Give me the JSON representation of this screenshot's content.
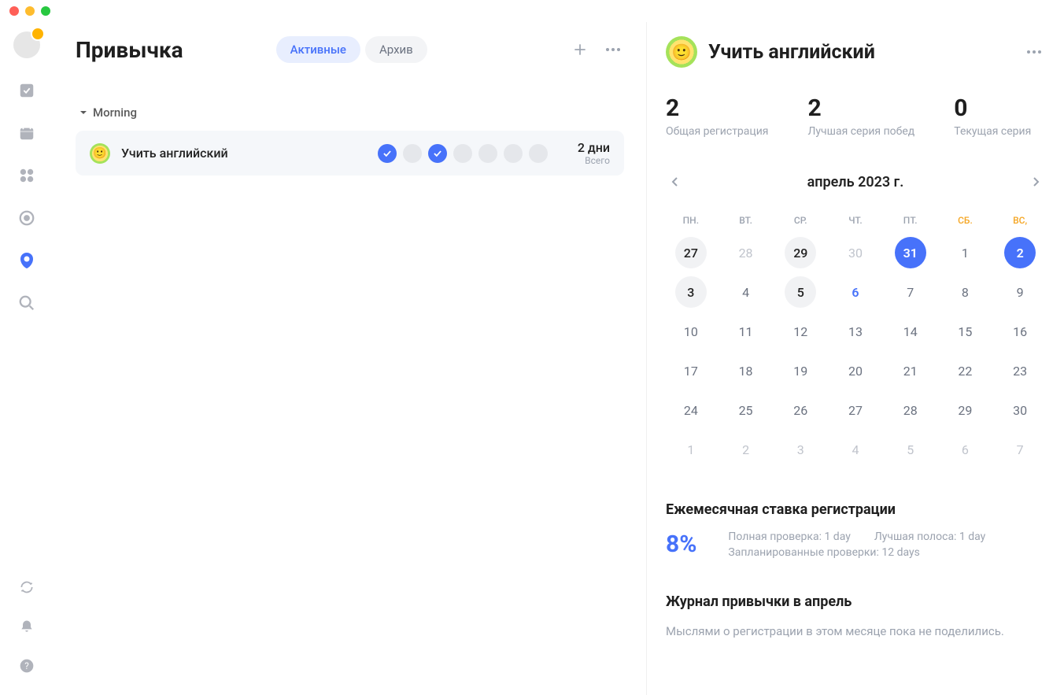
{
  "titlebar": {
    "dots": [
      "close",
      "minimize",
      "maximize"
    ]
  },
  "sidenav": {
    "items": [
      {
        "name": "tasks",
        "active": false
      },
      {
        "name": "calendar",
        "active": false
      },
      {
        "name": "matrix",
        "active": false
      },
      {
        "name": "focus",
        "active": false
      },
      {
        "name": "habit",
        "active": true
      },
      {
        "name": "search",
        "active": false
      }
    ],
    "bottom": [
      "sync",
      "notifications",
      "help"
    ]
  },
  "list": {
    "title": "Привычка",
    "tabs": {
      "active": "Активные",
      "archive": "Архив"
    },
    "section": "Morning",
    "habit": {
      "name": "Учить английский",
      "checks": [
        true,
        false,
        true,
        false,
        false,
        false,
        false
      ],
      "days_value": "2 дни",
      "days_label": "Всего"
    }
  },
  "detail": {
    "title": "Учить английский",
    "stats": [
      {
        "num": "2",
        "label": "Общая регистрация"
      },
      {
        "num": "2",
        "label": "Лучшая серия побед"
      },
      {
        "num": "0",
        "label": "Текущая серия"
      }
    ],
    "calendar": {
      "month": "апрель 2023 г.",
      "dow": [
        "ПН.",
        "ВТ.",
        "СР.",
        "ЧТ.",
        "ПТ.",
        "СБ.",
        "ВС,"
      ],
      "days": [
        {
          "d": "27",
          "cls": "other highlight"
        },
        {
          "d": "28",
          "cls": "other"
        },
        {
          "d": "29",
          "cls": "other highlight"
        },
        {
          "d": "30",
          "cls": "other"
        },
        {
          "d": "31",
          "cls": "done"
        },
        {
          "d": "1",
          "cls": "this"
        },
        {
          "d": "2",
          "cls": "done"
        },
        {
          "d": "3",
          "cls": "this highlight"
        },
        {
          "d": "4",
          "cls": "this"
        },
        {
          "d": "5",
          "cls": "this highlight"
        },
        {
          "d": "6",
          "cls": "this today"
        },
        {
          "d": "7",
          "cls": "this"
        },
        {
          "d": "8",
          "cls": "this"
        },
        {
          "d": "9",
          "cls": "this"
        },
        {
          "d": "10",
          "cls": "this"
        },
        {
          "d": "11",
          "cls": "this"
        },
        {
          "d": "12",
          "cls": "this"
        },
        {
          "d": "13",
          "cls": "this"
        },
        {
          "d": "14",
          "cls": "this"
        },
        {
          "d": "15",
          "cls": "this"
        },
        {
          "d": "16",
          "cls": "this"
        },
        {
          "d": "17",
          "cls": "this"
        },
        {
          "d": "18",
          "cls": "this"
        },
        {
          "d": "19",
          "cls": "this"
        },
        {
          "d": "20",
          "cls": "this"
        },
        {
          "d": "21",
          "cls": "this"
        },
        {
          "d": "22",
          "cls": "this"
        },
        {
          "d": "23",
          "cls": "this"
        },
        {
          "d": "24",
          "cls": "this"
        },
        {
          "d": "25",
          "cls": "this"
        },
        {
          "d": "26",
          "cls": "this"
        },
        {
          "d": "27",
          "cls": "this"
        },
        {
          "d": "28",
          "cls": "this"
        },
        {
          "d": "29",
          "cls": "this"
        },
        {
          "d": "30",
          "cls": "this"
        },
        {
          "d": "1",
          "cls": "other"
        },
        {
          "d": "2",
          "cls": "other"
        },
        {
          "d": "3",
          "cls": "other"
        },
        {
          "d": "4",
          "cls": "other"
        },
        {
          "d": "5",
          "cls": "other"
        },
        {
          "d": "6",
          "cls": "other"
        },
        {
          "d": "7",
          "cls": "other"
        }
      ]
    },
    "monthly": {
      "title": "Ежемесячная ставка регистрации",
      "pct": "8%",
      "full": "Полная проверка: 1 day",
      "streak": "Лучшая полоса: 1 day",
      "planned": "Запланированные проверки: 12 days"
    },
    "journal": {
      "title": "Журнал привычки в апрель",
      "empty": "Мыслями о регистрации в этом месяце пока не поделились."
    }
  }
}
